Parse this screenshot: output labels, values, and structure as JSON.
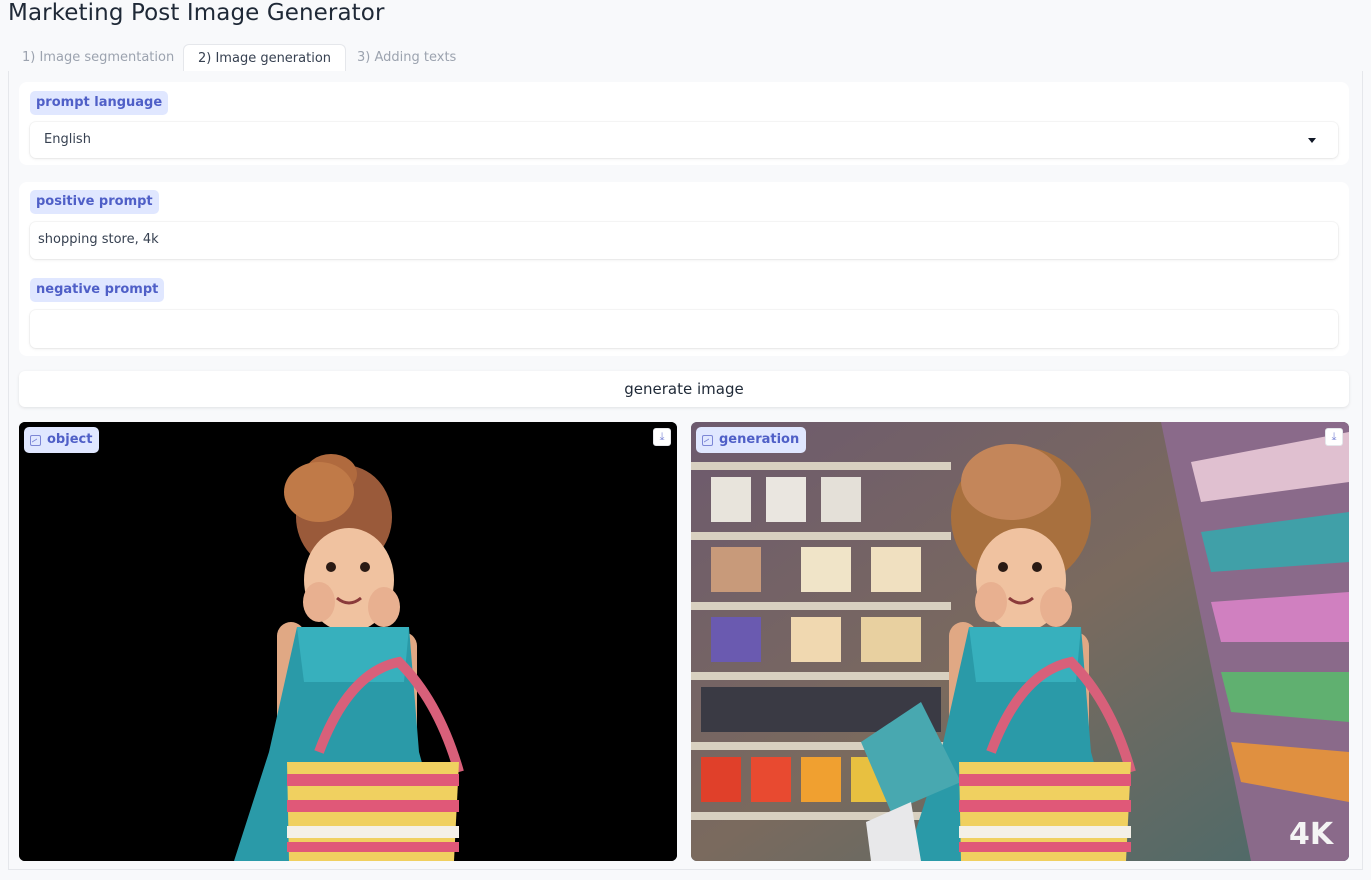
{
  "app": {
    "title": "Marketing Post Image Generator"
  },
  "tabs": [
    {
      "label": "1) Image segmentation",
      "active": false
    },
    {
      "label": "2) Image generation",
      "active": true
    },
    {
      "label": "3) Adding texts",
      "active": false
    }
  ],
  "language": {
    "label": "prompt language",
    "value": "English"
  },
  "positive": {
    "label": "positive prompt",
    "value": "shopping store, 4k"
  },
  "negative": {
    "label": "negative prompt",
    "value": ""
  },
  "generate_button": {
    "label": "generate image"
  },
  "outputs": {
    "object": {
      "label": "object",
      "icon": "image-icon",
      "download_icon": "download-icon"
    },
    "generation": {
      "label": "generation",
      "icon": "image-icon",
      "download_icon": "download-icon",
      "watermark": "4K"
    }
  },
  "colors": {
    "accent_bg": "#e0e7ff",
    "accent_text": "#4f5fc7"
  }
}
